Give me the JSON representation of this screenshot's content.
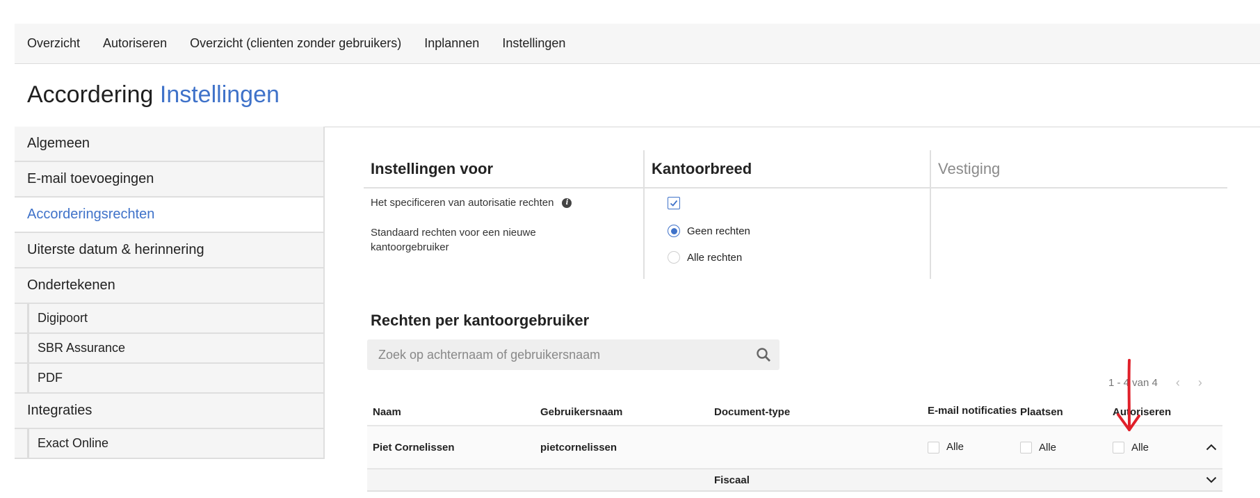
{
  "topnav": {
    "items": [
      "Overzicht",
      "Autoriseren",
      "Overzicht (clienten zonder gebruikers)",
      "Inplannen",
      "Instellingen"
    ]
  },
  "page_title": {
    "prefix": "Accordering",
    "accent": "Instellingen"
  },
  "sidebar": {
    "items": [
      {
        "label": "Algemeen"
      },
      {
        "label": "E-mail toevoegingen"
      },
      {
        "label": "Accorderingsrechten"
      },
      {
        "label": "Uiterste datum & herinnering"
      },
      {
        "label": "Ondertekenen"
      },
      {
        "label": "Digipoort"
      },
      {
        "label": "SBR Assurance"
      },
      {
        "label": "PDF"
      },
      {
        "label": "Integraties"
      },
      {
        "label": "Exact Online"
      }
    ]
  },
  "settings": {
    "col_for": "Instellingen voor",
    "col_office": "Kantoorbreed",
    "col_branch": "Vestiging",
    "row1_label": "Het specificeren van autorisatie rechten",
    "row2_label": "Standaard rechten voor een nieuwe kantoorgebruiker",
    "radio_none": "Geen rechten",
    "radio_all": "Alle rechten"
  },
  "rights": {
    "title": "Rechten per kantoorgebruiker",
    "search_placeholder": "Zoek op achternaam of gebruikersnaam",
    "pager": "1 - 4 van 4",
    "headers": {
      "name": "Naam",
      "username": "Gebruikersnaam",
      "doctype": "Document-type",
      "email": "E-mail notificaties",
      "place": "Plaatsen",
      "authorize": "Autoriseren"
    },
    "row": {
      "name": "Piet Cornelissen",
      "username": "pietcornelissen",
      "all": "Alle"
    },
    "subrow": {
      "doctype": "Fiscaal"
    }
  },
  "colors": {
    "accent": "#3f72c9",
    "annotation": "#e0202a"
  }
}
